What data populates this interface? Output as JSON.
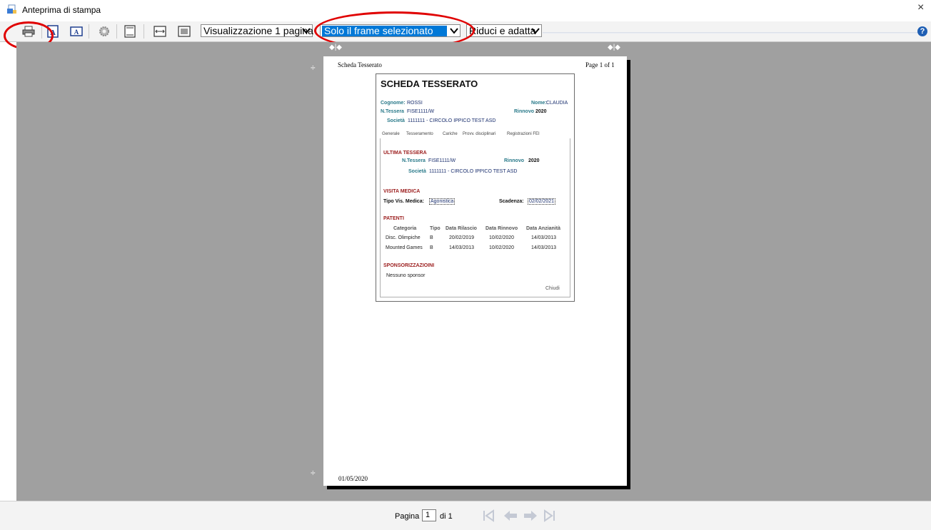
{
  "window": {
    "title": "Anteprima di stampa",
    "close_glyph": "×"
  },
  "toolbar": {
    "view_select": "Visualizzazione 1 pagina",
    "frame_select": "Solo il frame selezionato",
    "fit_select": "Riduci e adatta",
    "help_glyph": "?"
  },
  "page": {
    "header_left": "Scheda Tesserato",
    "header_right": "Page 1 of 1",
    "footer_date": "01/05/2020"
  },
  "card": {
    "title": "SCHEDA TESSERATO",
    "cognome_label": "Cognome:",
    "cognome": "ROSSI",
    "nome_label": "Nome:",
    "nome": "CLAUDIA",
    "tessera_label": "N.Tessera",
    "tessera": "FISE1111/W",
    "rinnovo_label": "Rinnovo",
    "rinnovo": "2020",
    "societa_label": "Società",
    "societa": "1111111 - CIRCOLO IPPICO TEST ASD",
    "tabs": [
      "Generale",
      "Tesseramento",
      "Cariche",
      "Provv. disciplinari",
      "Registrazioni FEI"
    ],
    "ultima_title": "ULTIMA TESSERA",
    "visita_title": "VISITA MEDICA",
    "tipo_label": "Tipo Vis. Medica:",
    "tipo_value": "Agonistica",
    "scadenza_label": "Scadenza:",
    "scadenza_value": "02/02/2021",
    "patenti_title": "PATENTI",
    "patenti_headers": [
      "Categoria",
      "Tipo",
      "Data Rilascio",
      "Data Rinnovo",
      "Data Anzianità"
    ],
    "patenti_rows": [
      [
        "Disc. Olimpiche",
        "B",
        "20/02/2019",
        "10/02/2020",
        "14/03/2013"
      ],
      [
        "Mounted Games",
        "B",
        "14/03/2013",
        "10/02/2020",
        "14/03/2013"
      ]
    ],
    "sponsor_title": "SPONSORIZZAZIOINI",
    "sponsor_value": "Nessuno sponsor",
    "chiudi": "Chiudi"
  },
  "pagination": {
    "label": "Pagina",
    "current": "1",
    "of_label": "di 1"
  },
  "colors": {
    "highlight": "#0078d7",
    "annotation_ring": "#e00000",
    "section_red": "#9b1c1c",
    "label_teal": "#2a7a8a"
  }
}
